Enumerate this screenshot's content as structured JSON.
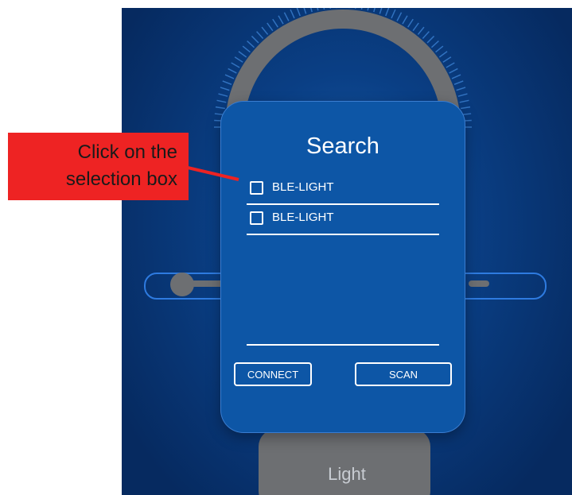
{
  "dialog": {
    "title": "Search",
    "devices": [
      {
        "label": "BLE-LIGHT",
        "checked": false
      },
      {
        "label": "BLE-LIGHT",
        "checked": false
      }
    ],
    "connect_label": "CONNECT",
    "scan_label": "SCAN"
  },
  "bottom_tab": {
    "label": "Light"
  },
  "annotation": {
    "line1": "Click on the",
    "line2": "selection box"
  },
  "colors": {
    "background": "#0a3f85",
    "dialog": "#0d56a6",
    "annotation": "#ee2323",
    "control_gray": "#6d6f72"
  }
}
